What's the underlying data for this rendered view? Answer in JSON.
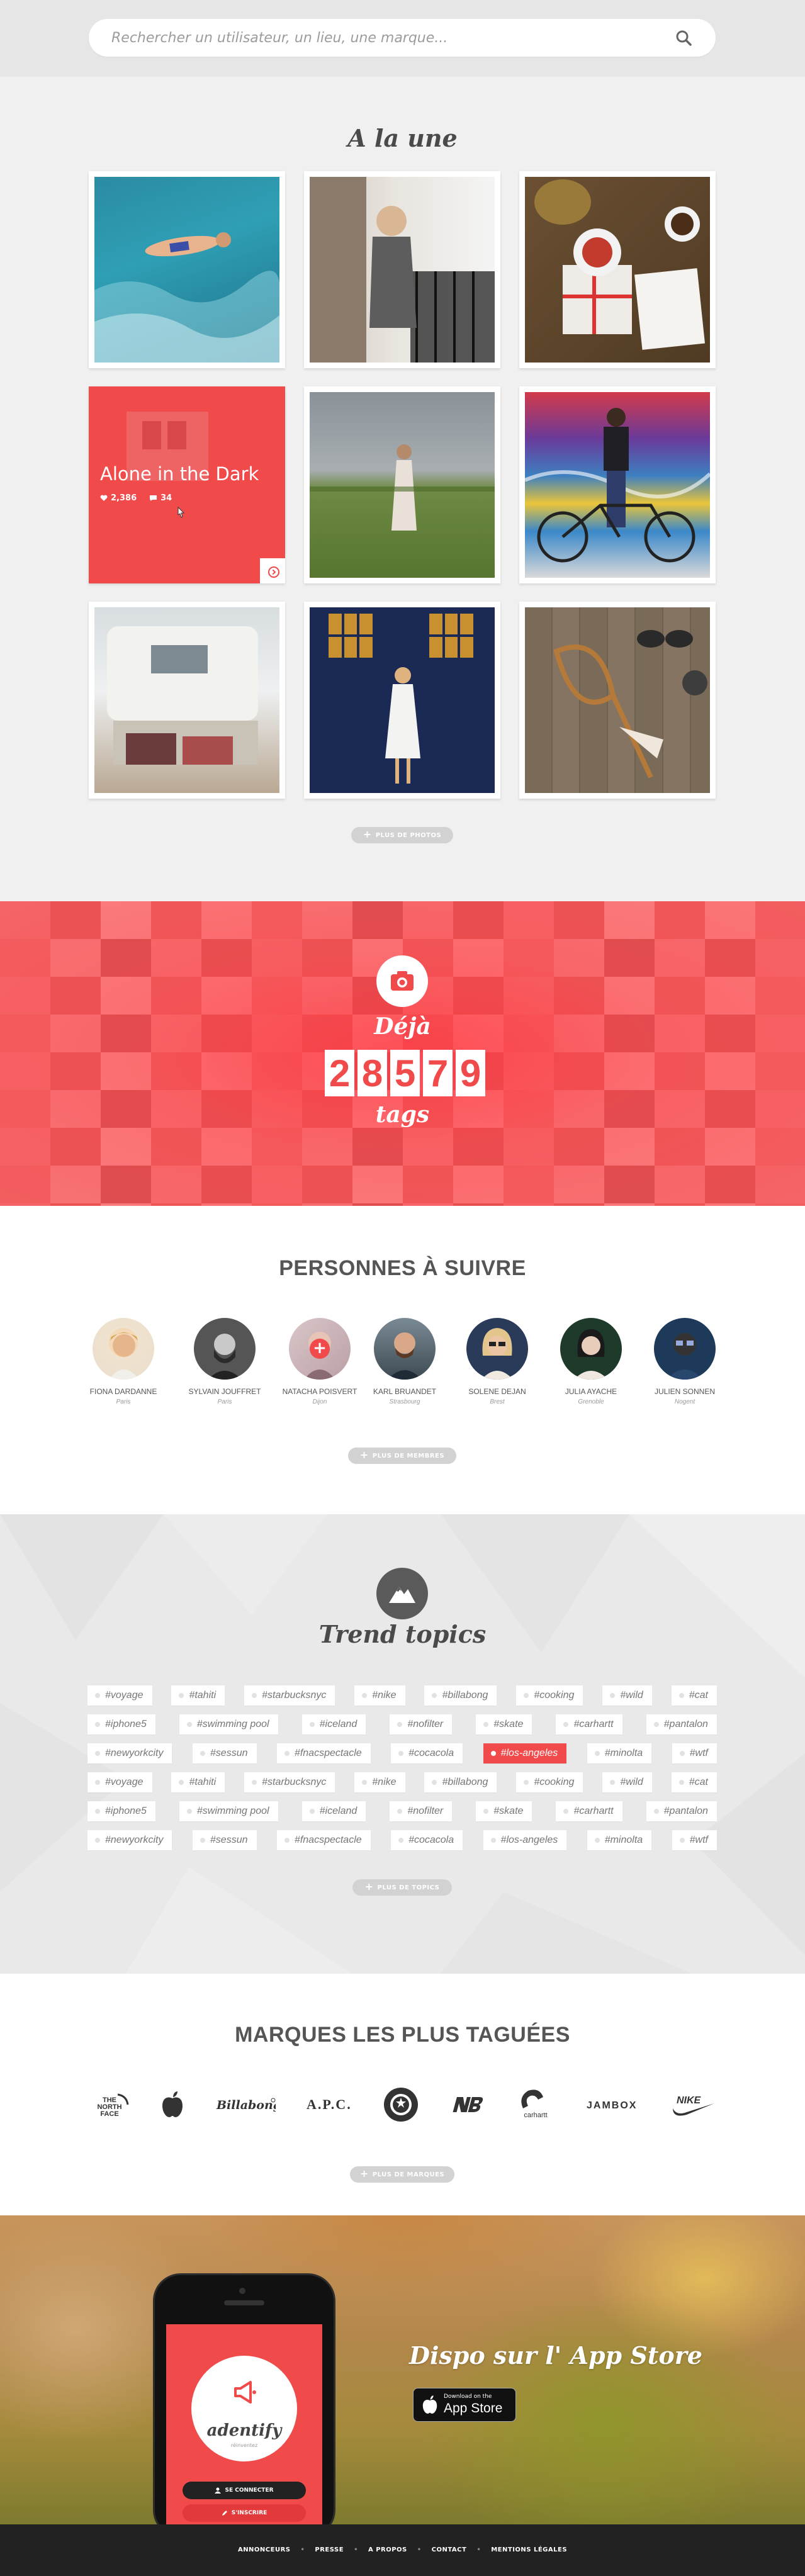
{
  "search": {
    "placeholder": "Rechercher un utilisateur, un lieu, une marque..."
  },
  "featured": {
    "title": "A la une",
    "hover_tile": {
      "title": "Alone in the Dark",
      "likes": "2,386",
      "comments": "34"
    },
    "more_label": "PLUS DE PHOTOS"
  },
  "counter": {
    "prefix": "Déjà",
    "digits": [
      "2",
      "8",
      "5",
      "7",
      "9"
    ],
    "suffix": "tags"
  },
  "people": {
    "title": "PERSONNES À SUIVRE",
    "items": [
      {
        "name": "FIONA DARDANNE",
        "city": "Paris"
      },
      {
        "name": "SYLVAIN JOUFFRET",
        "city": "Paris"
      },
      {
        "name": "NATACHA POISVERT",
        "city": "Dijon"
      },
      {
        "name": "KARL BRUANDET",
        "city": "Strasbourg"
      },
      {
        "name": "SOLENE DEJAN",
        "city": "Brest"
      },
      {
        "name": "JULIA AYACHE",
        "city": "Grenoble"
      },
      {
        "name": "JULIEN SONNEN",
        "city": "Nogent"
      }
    ],
    "more_label": "PLUS DE MEMBRES"
  },
  "trends": {
    "title": "Trend topics",
    "rows": [
      [
        "#voyage",
        "#tahiti",
        "#starbucksnyc",
        "#nike",
        "#billabong",
        "#cooking",
        "#wild",
        "#cat"
      ],
      [
        "#iphone5",
        "#swimming pool",
        "#iceland",
        "#nofilter",
        "#skate",
        "#carhartt",
        "#pantalon"
      ],
      [
        "#newyorkcity",
        "#sessun",
        "#fnacspectacle",
        "#cocacola",
        "#los-angeles",
        "#minolta",
        "#wtf"
      ],
      [
        "#voyage",
        "#tahiti",
        "#starbucksnyc",
        "#nike",
        "#billabong",
        "#cooking",
        "#wild",
        "#cat"
      ],
      [
        "#iphone5",
        "#swimming pool",
        "#iceland",
        "#nofilter",
        "#skate",
        "#carhartt",
        "#pantalon"
      ],
      [
        "#newyorkcity",
        "#sessun",
        "#fnacspectacle",
        "#cocacola",
        "#los-angeles",
        "#minolta",
        "#wtf"
      ]
    ],
    "active_tag": "#los-angeles",
    "more_label": "PLUS DE TOPICS"
  },
  "brands": {
    "title": "MARQUES LES PLUS TAGUÉES",
    "items": [
      "THE NORTH FACE",
      "Apple",
      "Billabong",
      "A.P.C.",
      "Starbucks",
      "New Balance",
      "carhartt",
      "JAMBOX",
      "NIKE"
    ],
    "more_label": "PLUS DE MARQUES"
  },
  "app": {
    "headline": "Dispo sur l' App Store",
    "store_small": "Download on the",
    "store_large": "App Store",
    "phone": {
      "logo": "adentify",
      "logo_sub": "réinventez",
      "connect": "SE CONNECTER",
      "register": "S'INSCRIRE"
    }
  },
  "footer": {
    "links": [
      "ANNONCEURS",
      "PRESSE",
      "A PROPOS",
      "CONTACT",
      "MENTIONS LÉGALES"
    ]
  },
  "colors": {
    "accent": "#f04a4a",
    "grey_button": "#d2d2d2",
    "footer": "#222222"
  }
}
